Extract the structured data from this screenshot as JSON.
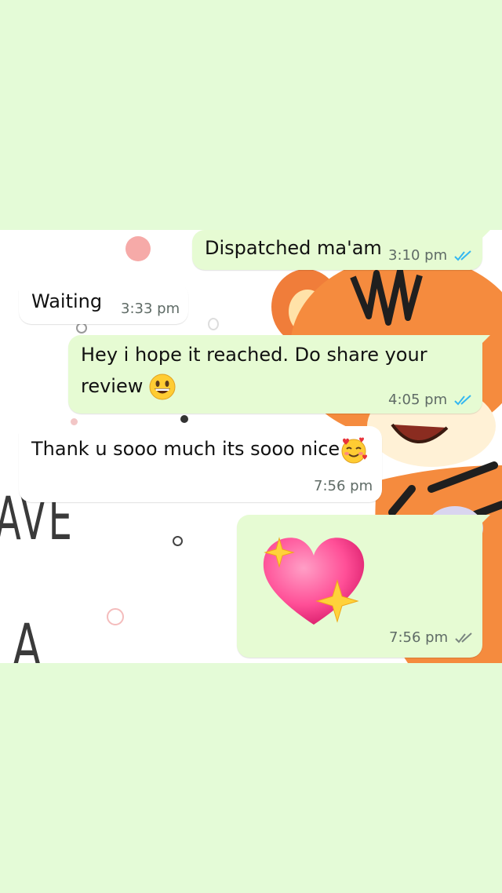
{
  "colors": {
    "page_background": "#e4fbd7",
    "chat_background": "#ffffff",
    "outgoing_bubble": "#e6fbd3",
    "incoming_bubble": "#ffffff",
    "read_tick": "#34b7f1",
    "delivered_tick": "#7a8580"
  },
  "wallpaper": {
    "text_line_1": "AVE",
    "text_line_2": "A"
  },
  "messages": [
    {
      "direction": "outgoing",
      "text": "Dispatched ma'am",
      "time": "3:10 pm",
      "status": "read"
    },
    {
      "direction": "incoming",
      "text": "Waiting",
      "time": "3:33 pm"
    },
    {
      "direction": "outgoing",
      "text_line_1": "Hey i hope it reached. Do share your",
      "text_line_2": "review",
      "emoji": "grinning-face",
      "time": "4:05 pm",
      "status": "read"
    },
    {
      "direction": "incoming",
      "text": "Thank u sooo much its sooo nice",
      "emoji": "smiling-face-with-hearts",
      "time": "7:56 pm"
    },
    {
      "direction": "outgoing",
      "emoji": "sparkling-heart",
      "time": "7:56 pm",
      "status": "delivered"
    }
  ]
}
